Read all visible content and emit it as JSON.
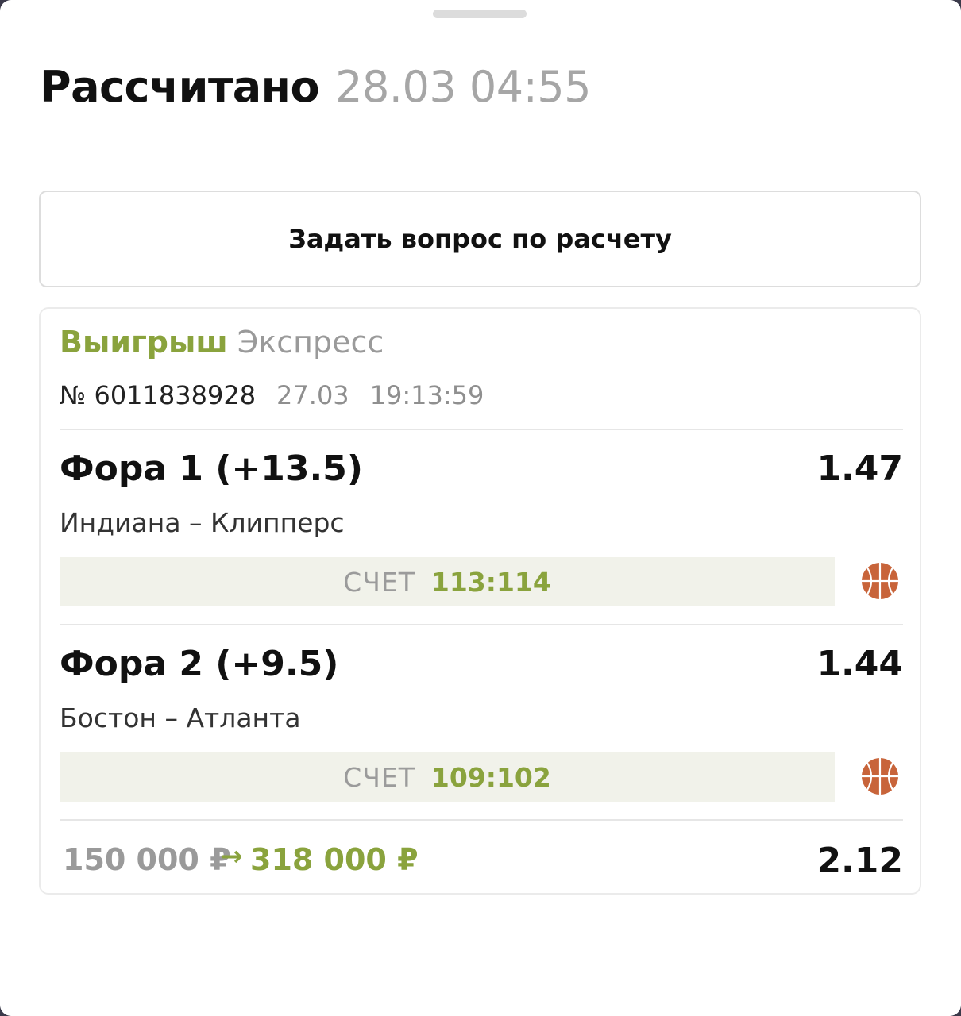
{
  "header": {
    "title": "Рассчитано",
    "settled_at": "28.03 04:55"
  },
  "ask_button": {
    "label": "Задать вопрос по расчету"
  },
  "bet": {
    "status": "Выигрыш",
    "type": "Экспресс",
    "number": "№ 6011838928",
    "date": "27.03",
    "time": "19:13:59",
    "events": [
      {
        "market": "Фора 1 (+13.5)",
        "odds": "1.47",
        "teams": "Индиана – Клипперс",
        "score_label": "СЧЕТ",
        "score": "113:114",
        "sport_icon": "basketball-icon"
      },
      {
        "market": "Фора 2 (+9.5)",
        "odds": "1.44",
        "teams": "Бостон – Атланта",
        "score_label": "СЧЕТ",
        "score": "109:102",
        "sport_icon": "basketball-icon"
      }
    ],
    "stake": "150 000 ₽",
    "arrow": "→",
    "payout": "318 000 ₽",
    "total_odds": "2.12"
  },
  "colors": {
    "win_green": "#8aa33d",
    "score_bg": "#f1f2ea",
    "basketball": "#c8643a"
  }
}
